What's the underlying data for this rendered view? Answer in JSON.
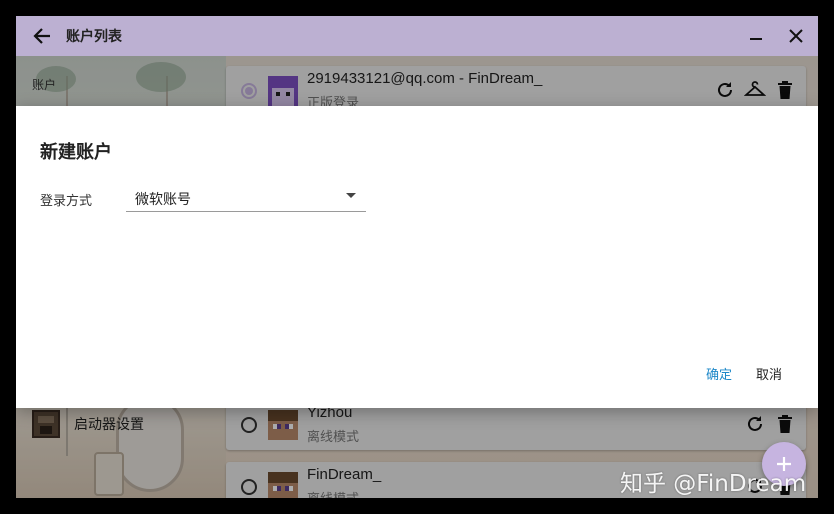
{
  "window": {
    "title": "账户列表"
  },
  "sidebar": {
    "section_label": "账户",
    "launcher_settings_label": "启动器设置"
  },
  "accounts": [
    {
      "name": "2919433121@qq.com - FinDream_",
      "type": "正版登录",
      "selected": true,
      "avatar": "purple-skin"
    },
    {
      "name": "Yizhou",
      "type": "离线模式",
      "selected": false,
      "avatar": "steve-skin"
    },
    {
      "name": "FinDream_",
      "type": "离线模式",
      "selected": false,
      "avatar": "steve-skin"
    }
  ],
  "dialog": {
    "title": "新建账户",
    "login_method_label": "登录方式",
    "login_method_value": "微软账号",
    "confirm_label": "确定",
    "cancel_label": "取消"
  },
  "watermark": "知乎 @FinDream",
  "colors": {
    "titlebar": "#bcb0d2",
    "accent": "#c6b4e0",
    "confirm": "#1e88c8"
  },
  "icons": [
    "back-arrow-icon",
    "minimize-icon",
    "close-icon",
    "refresh-icon",
    "hanger-icon",
    "trash-icon",
    "plus-icon"
  ]
}
